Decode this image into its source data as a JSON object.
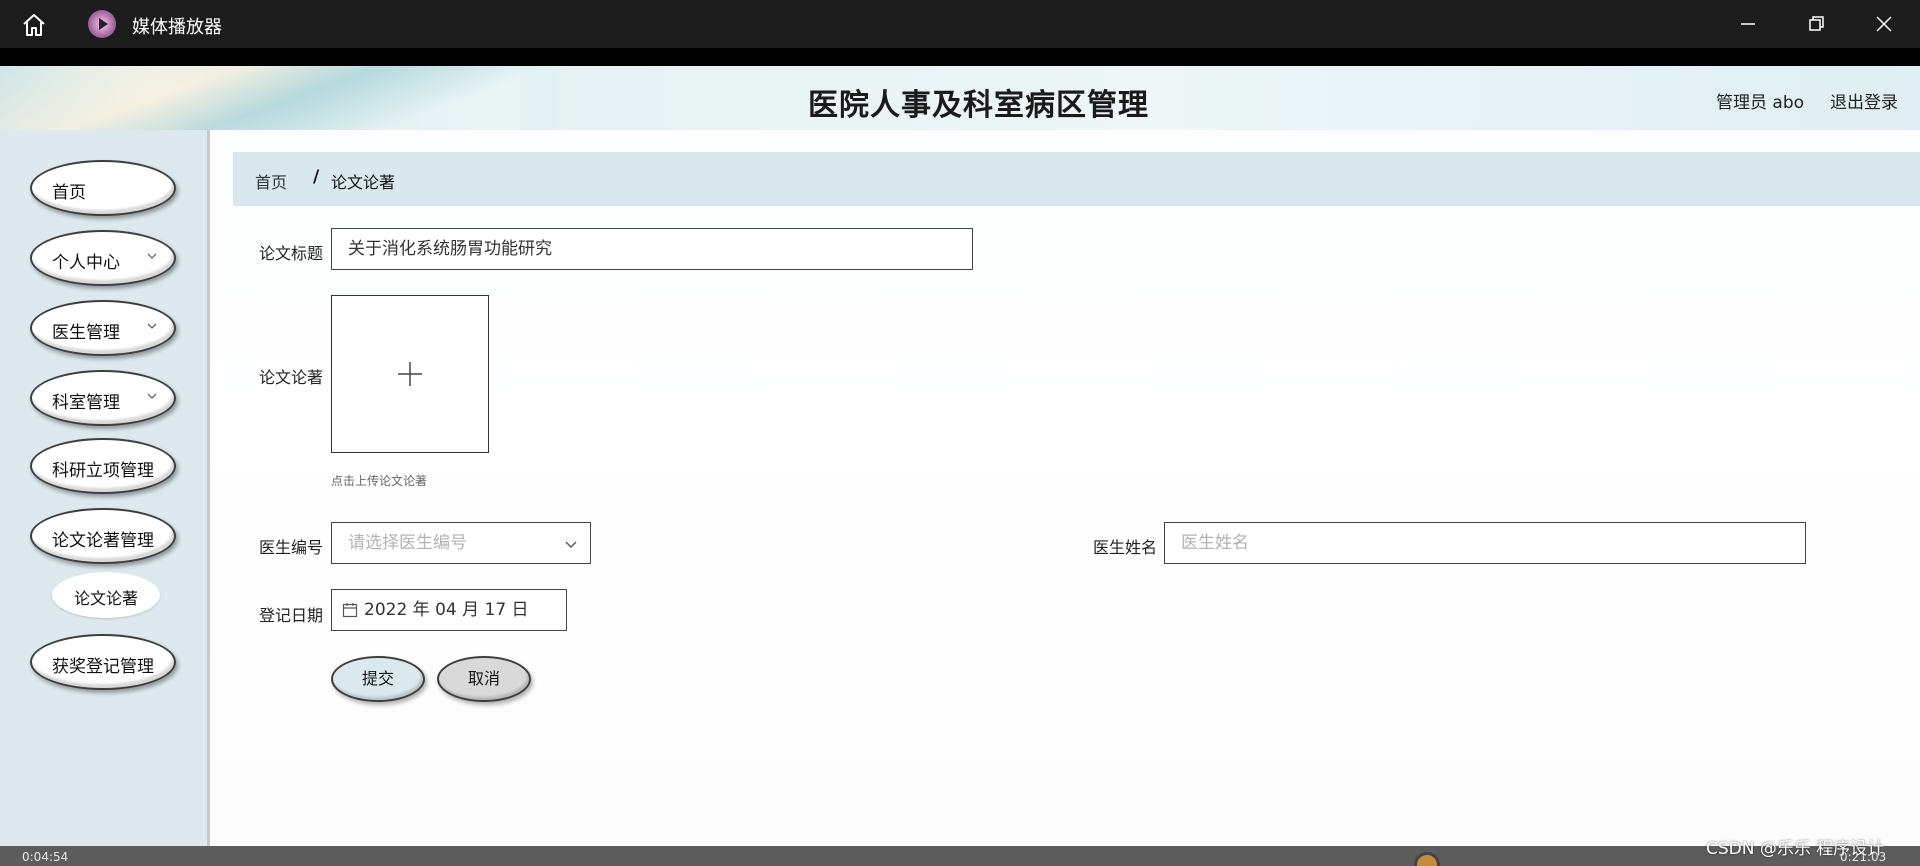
{
  "window": {
    "app_title": "媒体播放器"
  },
  "header": {
    "title": "医院人事及科室病区管理",
    "admin": "管理员 abo",
    "logout": "退出登录"
  },
  "sidebar": {
    "items": [
      {
        "label": "首页"
      },
      {
        "label": "个人中心"
      },
      {
        "label": "医生管理"
      },
      {
        "label": "科室管理"
      },
      {
        "label": "科研立项管理"
      },
      {
        "label": "论文论著管理"
      },
      {
        "label": "获奖登记管理"
      }
    ],
    "sub_item": "论文论著"
  },
  "breadcrumb": {
    "home": "首页",
    "separator": "/",
    "current": "论文论著"
  },
  "form": {
    "title_label": "论文标题",
    "title_value": "关于消化系统肠胃功能研究",
    "upload_label": "论文论著",
    "upload_hint": "点击上传论文论著",
    "doctor_id_label": "医生编号",
    "doctor_id_placeholder": "请选择医生编号",
    "doctor_name_label": "医生姓名",
    "doctor_name_placeholder": "医生姓名",
    "date_label": "登记日期",
    "date_value": "2022 年 04 月 17 日",
    "submit": "提交",
    "cancel": "取消"
  },
  "player": {
    "time_left": "0:04:54",
    "time_right": "0:21:03"
  },
  "watermark": "CSDN @乐乐 程序设计"
}
